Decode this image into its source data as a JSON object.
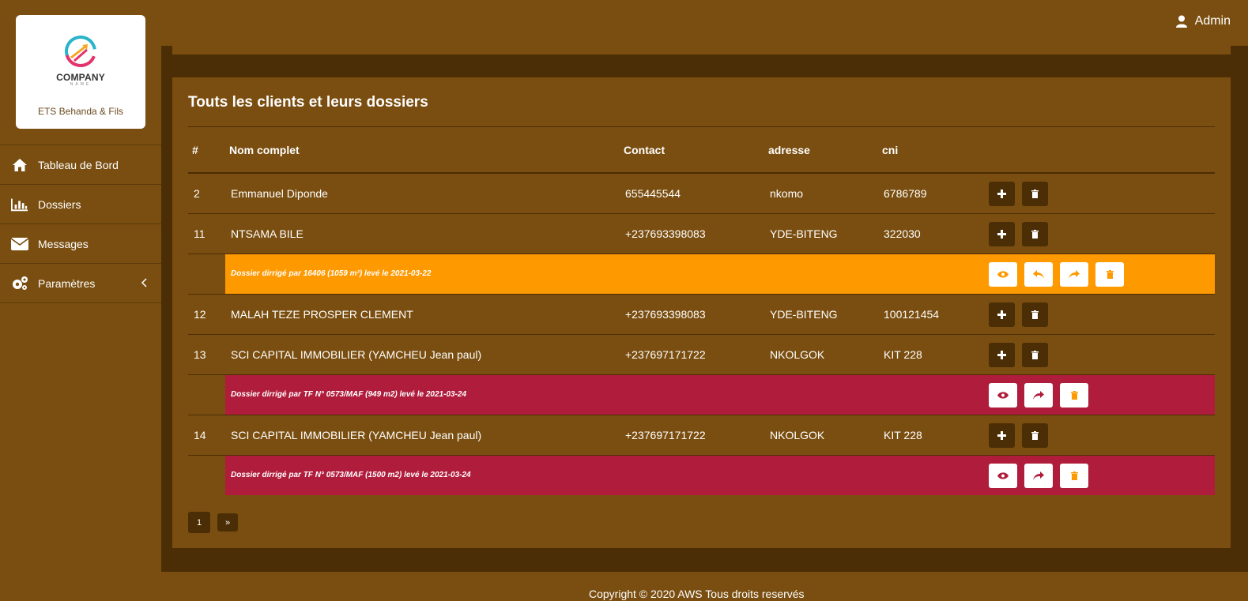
{
  "brand": {
    "logo_text": "COMPANY",
    "logo_sub": "NAME",
    "name": "ETS Behanda & Fils"
  },
  "sidebar": {
    "items": [
      {
        "label": "Tableau de Bord",
        "icon": "home-icon"
      },
      {
        "label": "Dossiers",
        "icon": "bar-chart-icon"
      },
      {
        "label": "Messages",
        "icon": "envelope-icon"
      },
      {
        "label": "Paramètres",
        "icon": "gears-icon"
      }
    ]
  },
  "header": {
    "user": "Admin"
  },
  "main": {
    "title": "Touts les clients et leurs dossiers",
    "columns": [
      "#",
      "Nom complet",
      "Contact",
      "adresse",
      "cni"
    ],
    "rows": [
      {
        "id": "2",
        "name": "Emmanuel Diponde",
        "contact": "655445544",
        "adresse": "nkomo",
        "cni": "6786789"
      },
      {
        "id": "11",
        "name": "NTSAMA BILE",
        "contact": "+237693398083",
        "adresse": "YDE-BITENG",
        "cni": "322030"
      },
      {
        "id": "12",
        "name": "MALAH TEZE PROSPER CLEMENT",
        "contact": "+237693398083",
        "adresse": "YDE-BITENG",
        "cni": "100121454"
      },
      {
        "id": "13",
        "name": "SCI CAPITAL IMMOBILIER (YAMCHEU Jean paul)",
        "contact": "+237697171722",
        "adresse": "NKOLGOK",
        "cni": "KIT 228"
      },
      {
        "id": "14",
        "name": "SCI CAPITAL IMMOBILIER (YAMCHEU Jean paul)",
        "contact": "+237697171722",
        "adresse": "NKOLGOK",
        "cni": "KIT 228"
      }
    ],
    "dossiers": [
      {
        "text": "Dossier dirrigé par 16406 (1059 m²) levé le 2021-03-22",
        "color": "#ff9900"
      },
      {
        "text": "Dossier dirrigé par TF N° 0573/MAF (949 m2) levé le 2021-03-24",
        "color": "#b01c3c"
      },
      {
        "text": "Dossier dirrigé par TF N° 0573/MAF (1500 m2) levé le 2021-03-24",
        "color": "#b01c3c"
      }
    ]
  },
  "pagination": {
    "current": "1",
    "next": "»"
  },
  "footer": {
    "text": "Copyright © 2020 AWS Tous droits reservés"
  },
  "colors": {
    "background": "#7a4e10",
    "panel_dark": "#4b2e05",
    "status_orange": "#ff9900",
    "status_red": "#b01c3c"
  }
}
